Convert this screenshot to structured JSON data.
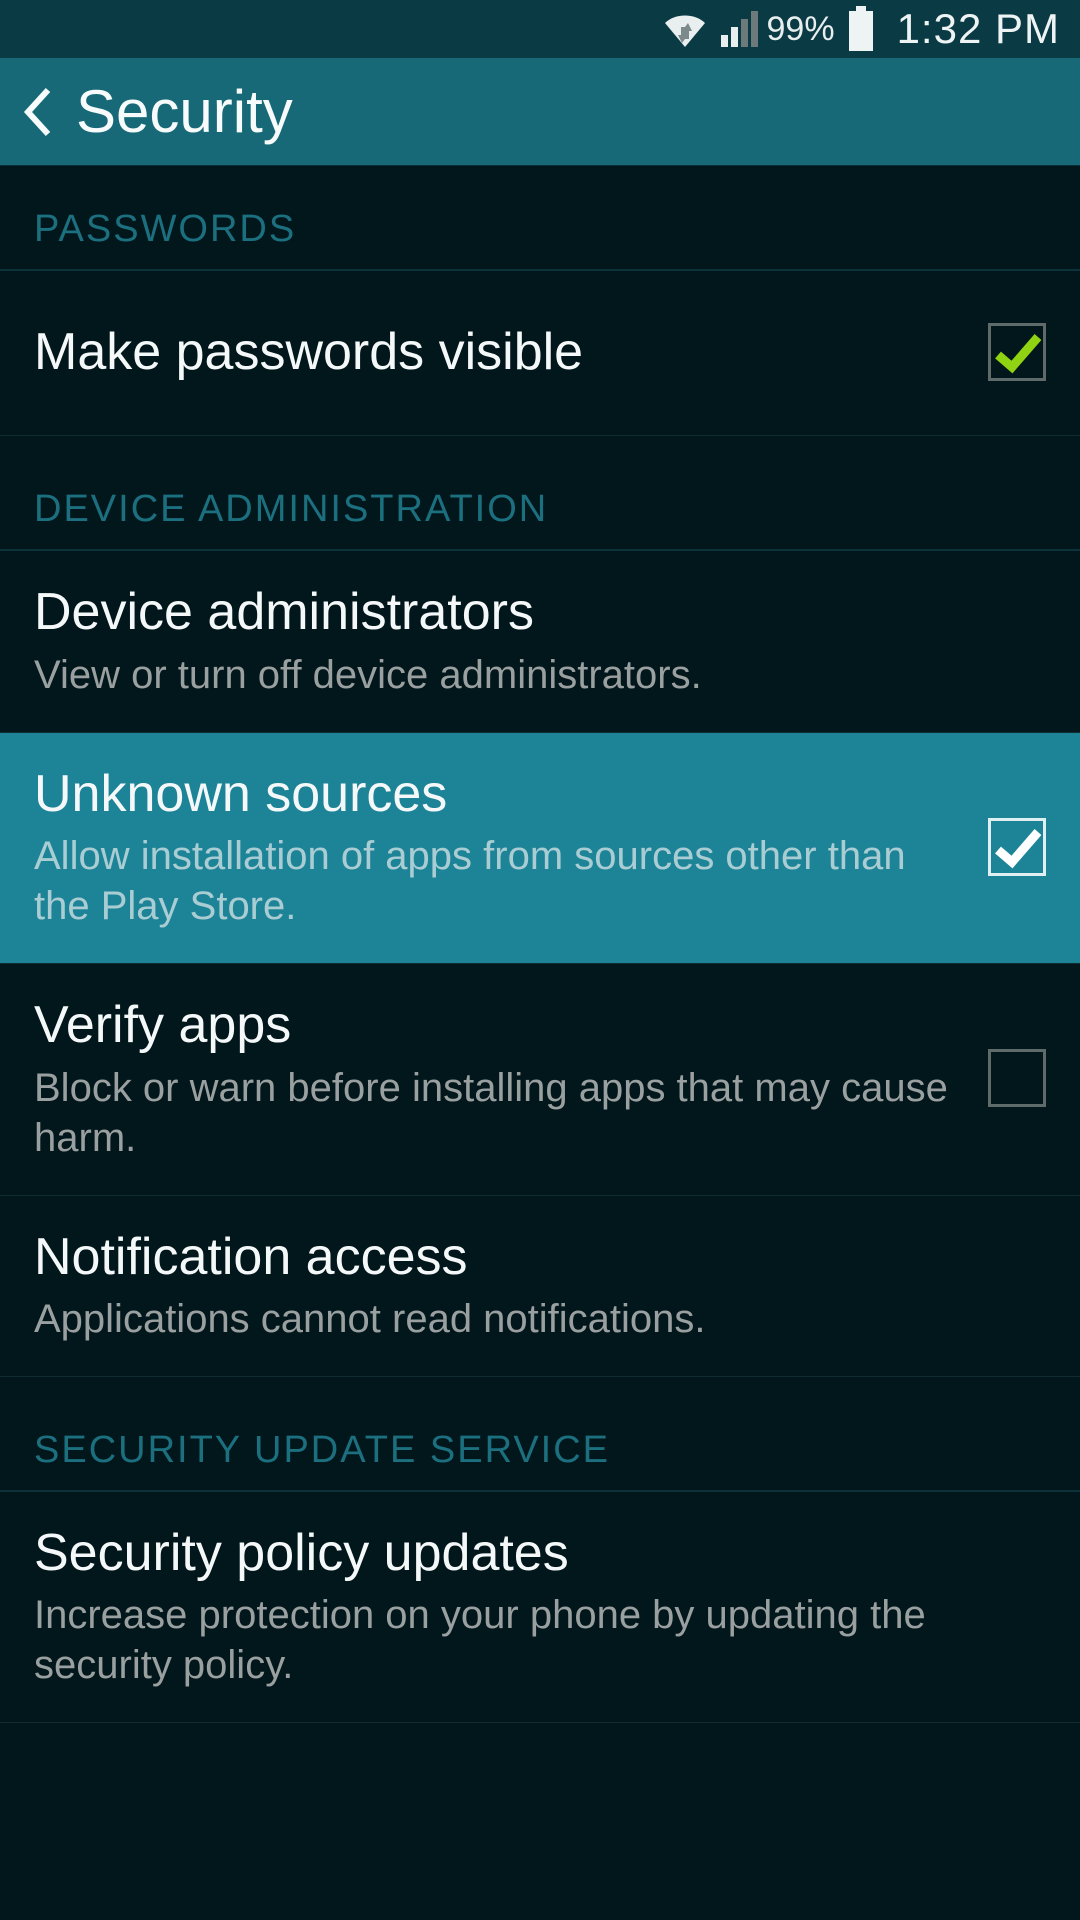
{
  "status": {
    "battery_pct": "99%",
    "time": "1:32 PM"
  },
  "header": {
    "title": "Security"
  },
  "sections": {
    "passwords": {
      "header": "PASSWORDS",
      "items": {
        "make_visible": {
          "title": "Make passwords visible"
        }
      }
    },
    "device_admin": {
      "header": "DEVICE ADMINISTRATION",
      "items": {
        "device_admins": {
          "title": "Device administrators",
          "sub": "View or turn off device administrators."
        },
        "unknown_sources": {
          "title": "Unknown sources",
          "sub": "Allow installation of apps from sources other than the Play Store."
        },
        "verify_apps": {
          "title": "Verify apps",
          "sub": "Block or warn before installing apps that may cause harm."
        },
        "notification_access": {
          "title": "Notification access",
          "sub": "Applications cannot read notifications."
        }
      }
    },
    "security_update": {
      "header": "SECURITY UPDATE SERVICE",
      "items": {
        "policy_updates": {
          "title": "Security policy updates",
          "sub": "Increase protection on your phone by updating the security policy."
        }
      }
    }
  }
}
